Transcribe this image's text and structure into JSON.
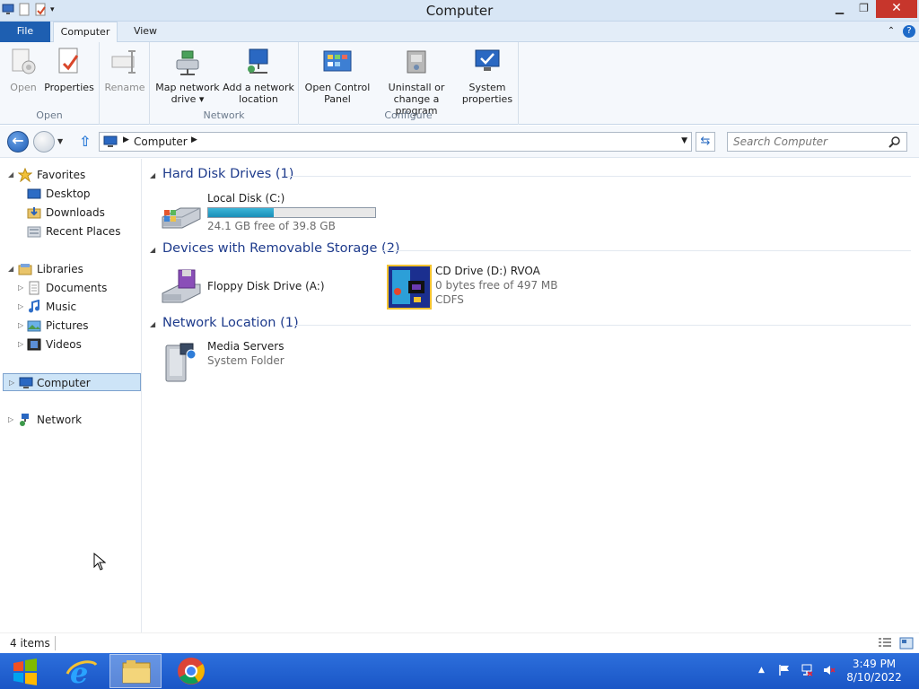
{
  "window": {
    "title": "Computer"
  },
  "ribbon": {
    "tabs": {
      "file": "File",
      "computer": "Computer",
      "view": "View"
    },
    "groups": {
      "open": {
        "label": "Open",
        "buttons": {
          "open": "Open",
          "properties": "Properties",
          "rename": "Rename"
        }
      },
      "network": {
        "label": "Network",
        "buttons": {
          "map_line1": "Map network",
          "map_line2": "drive ▾",
          "add_line1": "Add a network",
          "add_line2": "location"
        }
      },
      "configure": {
        "label": "Configure",
        "buttons": {
          "ocp_line1": "Open Control",
          "ocp_line2": "Panel",
          "uninst_line1": "Uninstall or",
          "uninst_line2": "change a program",
          "sys_line1": "System",
          "sys_line2": "properties"
        }
      }
    }
  },
  "address": {
    "crumb": "Computer",
    "search_placeholder": "Search Computer"
  },
  "nav": {
    "favorites": {
      "label": "Favorites",
      "items": [
        "Desktop",
        "Downloads",
        "Recent Places"
      ]
    },
    "libraries": {
      "label": "Libraries",
      "items": [
        "Documents",
        "Music",
        "Pictures",
        "Videos"
      ]
    },
    "computer": "Computer",
    "network": "Network"
  },
  "groups": {
    "hdd": {
      "title": "Hard Disk Drives (1)"
    },
    "removable": {
      "title": "Devices with Removable Storage (2)"
    },
    "netloc": {
      "title": "Network Location (1)"
    }
  },
  "items": {
    "local_disk": {
      "name": "Local Disk (C:)",
      "free": "24.1 GB free of 39.8 GB",
      "used_fraction": 0.395
    },
    "floppy": {
      "name": "Floppy Disk Drive (A:)"
    },
    "cd": {
      "name": "CD Drive (D:) RVOA",
      "free": "0 bytes free of 497 MB",
      "fs": "CDFS"
    },
    "media": {
      "name": "Media Servers",
      "type": "System Folder"
    }
  },
  "status": {
    "count": "4 items"
  },
  "taskbar": {
    "time": "3:49 PM",
    "date": "8/10/2022"
  }
}
